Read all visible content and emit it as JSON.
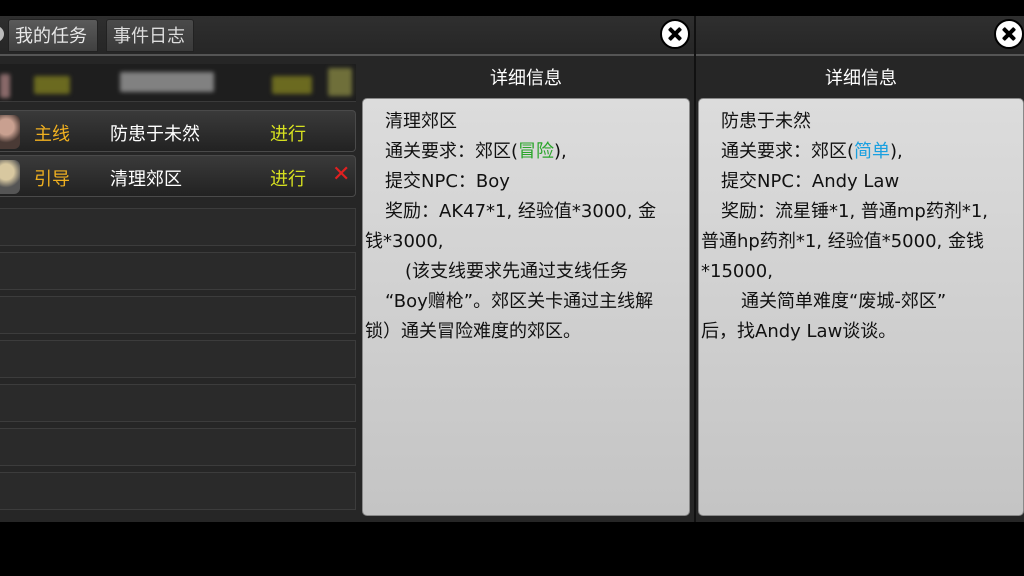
{
  "tabs": {
    "my_tasks": "我的任务",
    "event_log": "事件日志"
  },
  "quests": [
    {
      "type": "主线",
      "name": "防患于未然",
      "status": "进行"
    },
    {
      "type": "引导",
      "name": "清理郊区",
      "status": "进行",
      "delete": "✕"
    }
  ],
  "detail_left": {
    "title": "详细信息",
    "name": "清理郊区",
    "req_prefix": "通关要求：郊区(",
    "req_difficulty": "冒险",
    "req_suffix": "),",
    "npc": "提交NPC：Boy",
    "reward_1": "奖励：AK47*1, 经验值*3000, 金",
    "reward_2": "钱*3000,",
    "note_1": "(该支线要求先通过支线任务",
    "note_2": "“Boy赠枪”。郊区关卡通过主线解",
    "note_3": "锁）通关冒险难度的郊区。"
  },
  "detail_right": {
    "title": "详细信息",
    "name": "防患于未然",
    "req_prefix": "通关要求：郊区(",
    "req_difficulty": "简单",
    "req_suffix": "),",
    "npc": "提交NPC：Andy Law",
    "reward_1": "奖励：流星锤*1, 普通mp药剂*1,",
    "reward_2": "普通hp药剂*1, 经验值*5000, 金钱",
    "reward_3": "*15000,",
    "note_1": "通关简单难度“废城-郊区”",
    "note_2": "后，找Andy Law谈谈。"
  },
  "colors": {
    "difficulty_adventure": "#2aa52a",
    "difficulty_easy": "#1aa0e0",
    "quest_type": "#f0b020",
    "status": "#d6e020"
  },
  "icons": {
    "close": "close-icon",
    "delete": "delete-x-icon"
  }
}
